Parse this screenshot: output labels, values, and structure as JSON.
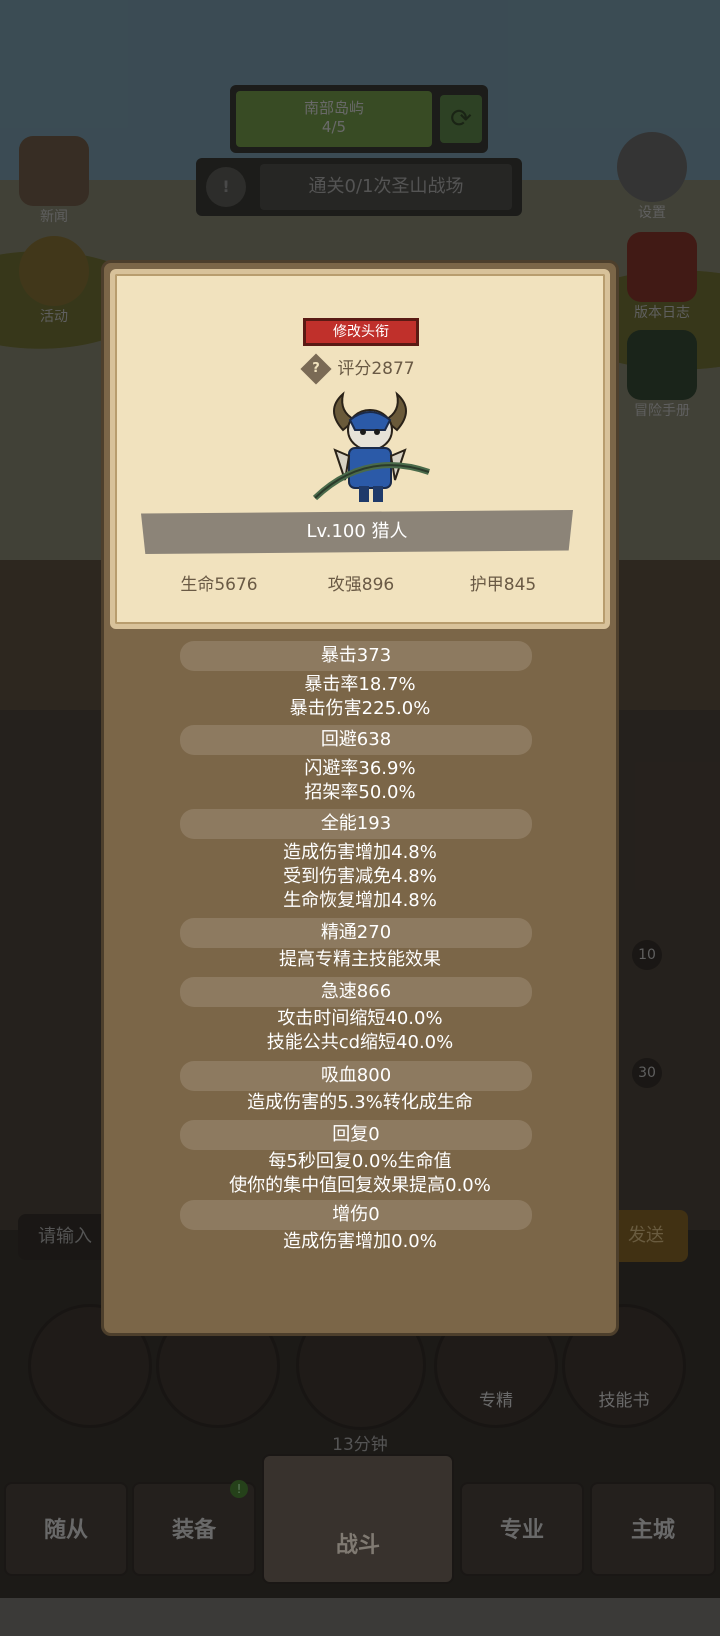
{
  "background": {
    "stage_name": "南部岛屿",
    "stage_progress": "4/5",
    "quest_text": "通关0/1次圣山战场",
    "left_buttons": [
      "新闻",
      "活动"
    ],
    "right_buttons": [
      "设置",
      "版本日志",
      "冒险手册"
    ],
    "chat_placeholder": "请输入",
    "send_label": "发送",
    "round_buttons": [
      "",
      "",
      "",
      "专精",
      "技能书"
    ],
    "timer": "13分钟",
    "badge": "!",
    "side_counts": [
      "10",
      "30"
    ],
    "nav_tabs": [
      "随从",
      "装备",
      "战斗",
      "专业",
      "主城"
    ]
  },
  "modal": {
    "title_button": "修改头衔",
    "help_icon": "?",
    "score": "评分2877",
    "level_class": "Lv.100 猎人",
    "hp": "生命5676",
    "attack": "攻强896",
    "armor": "护甲845",
    "sections": [
      {
        "head": "暴击373",
        "lines": [
          "暴击率18.7%",
          "暴击伤害225.0%"
        ]
      },
      {
        "head": "回避638",
        "lines": [
          "闪避率36.9%",
          "招架率50.0%"
        ]
      },
      {
        "head": "全能193",
        "lines": [
          "造成伤害增加4.8%",
          "受到伤害减免4.8%",
          "生命恢复增加4.8%"
        ]
      },
      {
        "head": "精通270",
        "lines": [
          "提高专精主技能效果"
        ]
      },
      {
        "head": "急速866",
        "lines": [
          "攻击时间缩短40.0%",
          "技能公共cd缩短40.0%"
        ]
      },
      {
        "head": "吸血800",
        "lines": [
          "造成伤害的5.3%转化成生命"
        ]
      },
      {
        "head": "回复0",
        "lines": [
          "每5秒回复0.0%生命值",
          "使你的集中值回复效果提高0.0%"
        ]
      },
      {
        "head": "增伤0",
        "lines": [
          "造成伤害增加0.0%"
        ]
      }
    ]
  },
  "colors": {
    "modal_bg": "#7b6648",
    "card_bg": "#f1e2be",
    "title_red": "#c0302b",
    "section_head": "#8d7a60"
  }
}
